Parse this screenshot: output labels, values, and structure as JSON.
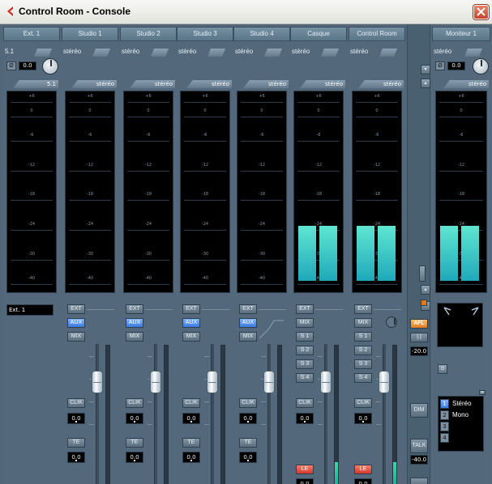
{
  "window": {
    "title": "Control Room - Console"
  },
  "channels": [
    {
      "name": "Ext. 1",
      "format": "5.1",
      "subformat": "5.1"
    },
    {
      "name": "Studio 1",
      "format": "stéréo",
      "subformat": "stéréo",
      "buttons": [
        "EXT",
        "AUX",
        "MIX"
      ],
      "clik": "CLIK",
      "clik_value": "0.0",
      "te": "TE",
      "te_value": "0.0"
    },
    {
      "name": "Studio 2",
      "format": "stéréo",
      "subformat": "stéréo",
      "buttons": [
        "EXT",
        "AUX",
        "MIX"
      ],
      "clik": "CLIK",
      "clik_value": "0.0",
      "te": "TE",
      "te_value": "0.0"
    },
    {
      "name": "Studio 3",
      "format": "stéréo",
      "subformat": "stéréo",
      "buttons": [
        "EXT",
        "AUX",
        "MIX"
      ],
      "clik": "CLIK",
      "clik_value": "0.0",
      "te": "TE",
      "te_value": "0.0"
    },
    {
      "name": "Studio 4",
      "format": "stéréo",
      "subformat": "stéréo",
      "buttons": [
        "EXT",
        "AUX",
        "MIX"
      ],
      "clik": "CLIK",
      "clik_value": "0.0",
      "te": "TE",
      "te_value": "0.0"
    },
    {
      "name": "Casque",
      "format": "stéréo",
      "subformat": "stéréo",
      "buttons": [
        "EXT",
        "MIX",
        "S 1",
        "S 2",
        "S 3",
        "S 4"
      ],
      "clik": "CLIK",
      "clik_value": "0.0",
      "le": "LE",
      "le_value": "0.0"
    },
    {
      "name": "Control Room",
      "format": "stéréo",
      "subformat": "stéréo",
      "buttons": [
        "EXT",
        "MIX",
        "S 1",
        "S 2",
        "S 3",
        "S 4"
      ],
      "clik": "CLIK",
      "clik_value": "0.0",
      "le": "LE",
      "le_value": "0.0"
    },
    {
      "name": "Moniteur 1",
      "format": "stéréo",
      "subformat": "stéréo"
    }
  ],
  "ext1_field": "Ext. 1",
  "phase_symbol": "Ø",
  "volume_value": "0.0",
  "meter_scale": [
    "+6",
    "0",
    "-6",
    "-12",
    "-18",
    "-24",
    "-30",
    "-40"
  ],
  "colors": {
    "meter": "#2fd2c4",
    "aux_button": "#3a7ae0",
    "le_button": "#d23a2a",
    "afl_button": "#e07a1c",
    "panel": "#53697b"
  },
  "middle": {
    "afl": "AFL",
    "afl_value": "-20.0",
    "dim": "DIM",
    "talk": "TALK",
    "talk_value": "-40.0"
  },
  "speakers": {
    "items": [
      {
        "number": "1",
        "label": "Stéréo",
        "selected": true
      },
      {
        "number": "2",
        "label": "Mono",
        "selected": false
      },
      {
        "number": "3",
        "label": "",
        "selected": false
      },
      {
        "number": "4",
        "label": "",
        "selected": false
      }
    ]
  },
  "levels": {
    "casque": 0.4,
    "control_room": 0.4,
    "moniteur": 0.4
  }
}
